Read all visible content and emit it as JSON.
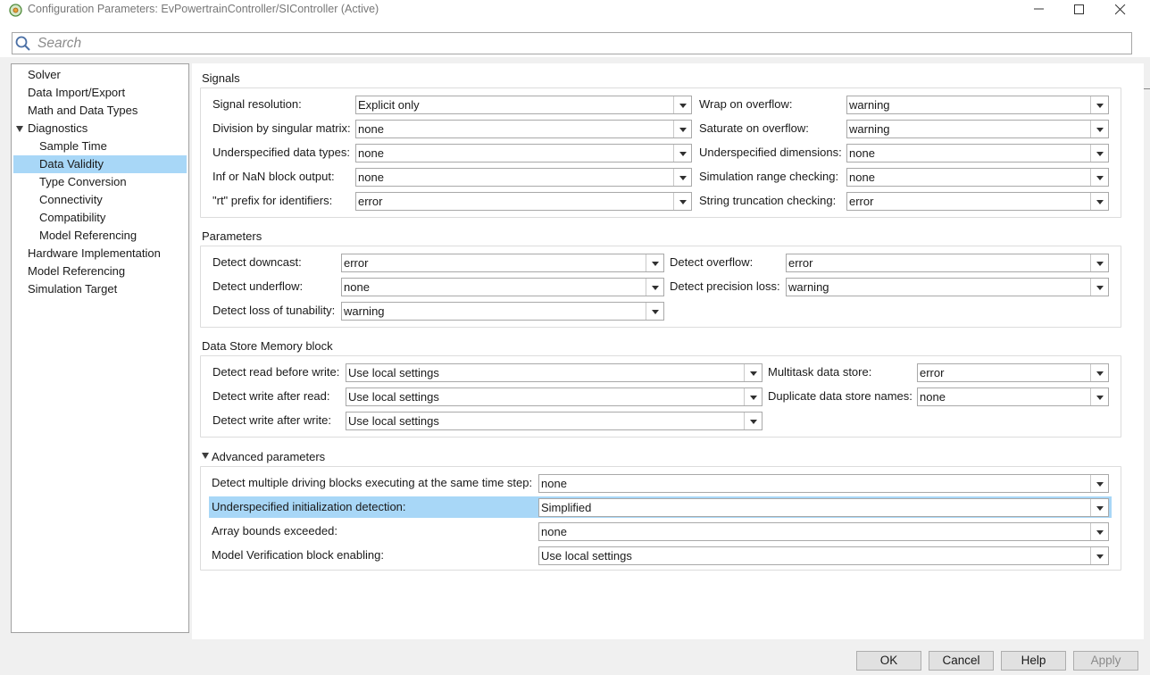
{
  "window": {
    "title": "Configuration Parameters: EvPowertrainController/SIController (Active)"
  },
  "search": {
    "placeholder": "Search"
  },
  "tree": {
    "items": [
      {
        "label": "Solver"
      },
      {
        "label": "Data Import/Export"
      },
      {
        "label": "Math and Data Types"
      },
      {
        "label": "Diagnostics",
        "expanded": true
      },
      {
        "label": "Sample Time"
      },
      {
        "label": "Data Validity",
        "selected": true
      },
      {
        "label": "Type Conversion"
      },
      {
        "label": "Connectivity"
      },
      {
        "label": "Compatibility"
      },
      {
        "label": "Model Referencing"
      },
      {
        "label": "Hardware Implementation"
      },
      {
        "label": "Model Referencing"
      },
      {
        "label": "Simulation Target"
      }
    ]
  },
  "signals": {
    "title": "Signals",
    "rows": [
      {
        "label": "Signal resolution:",
        "value": "Explicit only"
      },
      {
        "label": "Division by singular matrix:",
        "value": "none"
      },
      {
        "label": "Underspecified data types:",
        "value": "none"
      },
      {
        "label": "Inf or NaN block output:",
        "value": "none"
      },
      {
        "label": "\"rt\" prefix for identifiers:",
        "value": "error"
      }
    ],
    "rows_right": [
      {
        "label": "Wrap on overflow:",
        "value": "warning"
      },
      {
        "label": "Saturate on overflow:",
        "value": "warning"
      },
      {
        "label": "Underspecified dimensions:",
        "value": "none"
      },
      {
        "label": "Simulation range checking:",
        "value": "none"
      },
      {
        "label": "String truncation checking:",
        "value": "error"
      }
    ]
  },
  "parameters": {
    "title": "Parameters",
    "rows": [
      {
        "label": "Detect downcast:",
        "value": "error"
      },
      {
        "label": "Detect underflow:",
        "value": "none"
      },
      {
        "label": "Detect loss of tunability:",
        "value": "warning"
      }
    ],
    "rows_right": [
      {
        "label": "Detect overflow:",
        "value": "error"
      },
      {
        "label": "Detect precision loss:",
        "value": "warning"
      }
    ]
  },
  "dsm": {
    "title": "Data Store Memory block",
    "rows": [
      {
        "label": "Detect read before write:",
        "value": "Use local settings"
      },
      {
        "label": "Detect write after read:",
        "value": "Use local settings"
      },
      {
        "label": "Detect write after write:",
        "value": "Use local settings"
      }
    ],
    "rows_right": [
      {
        "label": "Multitask data store:",
        "value": "error"
      },
      {
        "label": "Duplicate data store names:",
        "value": "none"
      }
    ]
  },
  "advanced": {
    "title": "Advanced parameters",
    "rows": [
      {
        "label": "Detect multiple driving blocks executing at the same time step:",
        "value": "none"
      },
      {
        "label": "Underspecified initialization detection:",
        "value": "Simplified",
        "highlighted": true
      },
      {
        "label": "Array bounds exceeded:",
        "value": "none"
      },
      {
        "label": "Model Verification block enabling:",
        "value": "Use local settings"
      }
    ]
  },
  "buttons": {
    "ok": "OK",
    "cancel": "Cancel",
    "help": "Help",
    "apply": "Apply"
  },
  "colors": {
    "selection": "#a8d7f7",
    "border": "#a9a9a9"
  }
}
